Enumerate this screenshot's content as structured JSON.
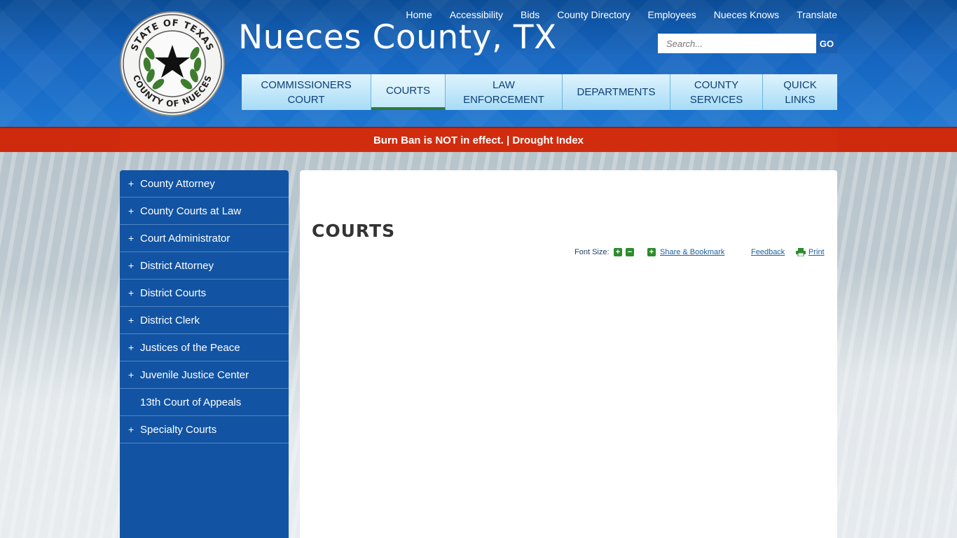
{
  "header": {
    "site_title": "Nueces County, TX",
    "seal": {
      "top_text": "STATE OF TEXAS",
      "bottom_text": "COUNTY OF NUECES"
    },
    "utility_nav": [
      "Home",
      "Accessibility",
      "Bids",
      "County Directory",
      "Employees",
      "Nueces Knows",
      "Translate"
    ],
    "search": {
      "placeholder": "Search...",
      "button_label": "GO"
    },
    "main_nav": [
      {
        "label": "COMMISSIONERS\nCOURT",
        "active": false
      },
      {
        "label": "COURTS",
        "active": true
      },
      {
        "label": "LAW\nENFORCEMENT",
        "active": false
      },
      {
        "label": "DEPARTMENTS",
        "active": false
      },
      {
        "label": "COUNTY\nSERVICES",
        "active": false
      },
      {
        "label": "QUICK\nLINKS",
        "active": false
      }
    ]
  },
  "alert": {
    "text": "Burn Ban is NOT in effect. | Drought Index"
  },
  "sidebar": {
    "items": [
      {
        "label": "County Attorney",
        "expandable": "+"
      },
      {
        "label": "County Courts at Law",
        "expandable": "+"
      },
      {
        "label": "Court Administrator",
        "expandable": "+"
      },
      {
        "label": "District Attorney",
        "expandable": "+"
      },
      {
        "label": "District Courts",
        "expandable": "+"
      },
      {
        "label": "District Clerk",
        "expandable": "+"
      },
      {
        "label": "Justices of the Peace",
        "expandable": "+"
      },
      {
        "label": "Juvenile Justice Center",
        "expandable": "+"
      },
      {
        "label": "13th Court of Appeals",
        "expandable": ""
      },
      {
        "label": "Specialty Courts",
        "expandable": "+"
      }
    ]
  },
  "content": {
    "title": "COURTS",
    "tools": {
      "font_size_label": "Font Size:",
      "increase_symbol": "+",
      "decrease_symbol": "−",
      "share_symbol": "+",
      "share_label": "Share & Bookmark",
      "feedback_label": "Feedback",
      "print_label": "Print"
    }
  },
  "colors": {
    "header_blue": "#1565c0",
    "nav_text": "#0e3f78",
    "alert_red": "#cf2a0d",
    "sidebar_blue": "#1254a3",
    "active_underline": "#2f7a35",
    "tool_green": "#2e8b2e"
  }
}
